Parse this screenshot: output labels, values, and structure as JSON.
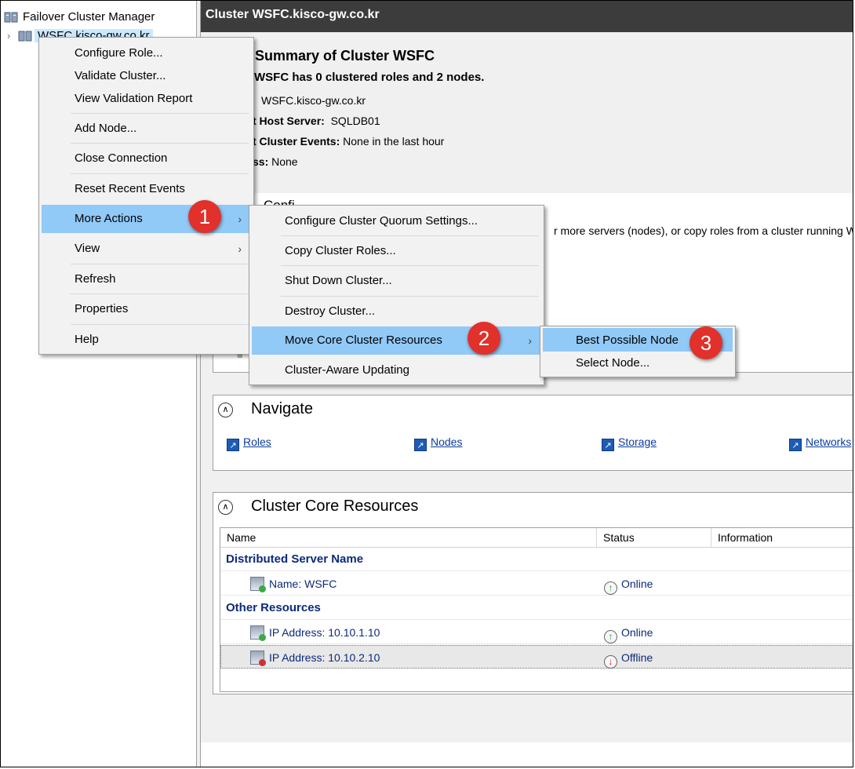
{
  "tree": {
    "root_label": "Failover Cluster Manager",
    "cluster_label": "WSFC.kisco-gw.co.kr"
  },
  "header": {
    "title": "Cluster WSFC.kisco-gw.co.kr"
  },
  "summary": {
    "title": "Summary of Cluster WSFC",
    "subtitle": "WSFC has 0 clustered roles and 2 nodes.",
    "name_value": "WSFC.kisco-gw.co.kr",
    "host_label": "t Host Server:",
    "host_value": "SQLDB01",
    "events_label": "t Cluster Events:",
    "events_value": "None in the last hour",
    "ss_label": "ss:",
    "ss_value": "None"
  },
  "overview": {
    "title": "Confi",
    "text": "r more servers (nodes), or copy roles from a cluster running W"
  },
  "navigate": {
    "title": "Navigate",
    "links": [
      "Roles",
      "Nodes",
      "Storage",
      "Networks"
    ]
  },
  "core": {
    "title": "Cluster Core Resources",
    "columns": [
      "Name",
      "Status",
      "Information"
    ],
    "groups": [
      {
        "name": "Distributed Server Name",
        "rows": [
          {
            "name": "Name: WSFC",
            "status": "Online"
          }
        ]
      },
      {
        "name": "Other Resources",
        "rows": [
          {
            "name": "IP Address: 10.10.1.10",
            "status": "Online"
          },
          {
            "name": "IP Address: 10.10.2.10",
            "status": "Offline"
          }
        ]
      }
    ]
  },
  "menu1": {
    "items": [
      "Configure Role...",
      "Validate Cluster...",
      "View Validation Report",
      "Add Node...",
      "Close Connection",
      "Reset Recent Events",
      "More Actions",
      "View",
      "Refresh",
      "Properties",
      "Help"
    ]
  },
  "menu2": {
    "items": [
      "Configure Cluster Quorum Settings...",
      "Copy Cluster Roles...",
      "Shut Down Cluster...",
      "Destroy Cluster...",
      "Move Core Cluster Resources",
      "Cluster-Aware Updating"
    ]
  },
  "menu3": {
    "items": [
      "Best Possible Node",
      "Select Node..."
    ]
  },
  "badges": [
    "1",
    "2",
    "3"
  ],
  "colors": {
    "menu_highlight": "#91c9f7",
    "badge": "#e2302a",
    "header": "#3c3c3c"
  }
}
